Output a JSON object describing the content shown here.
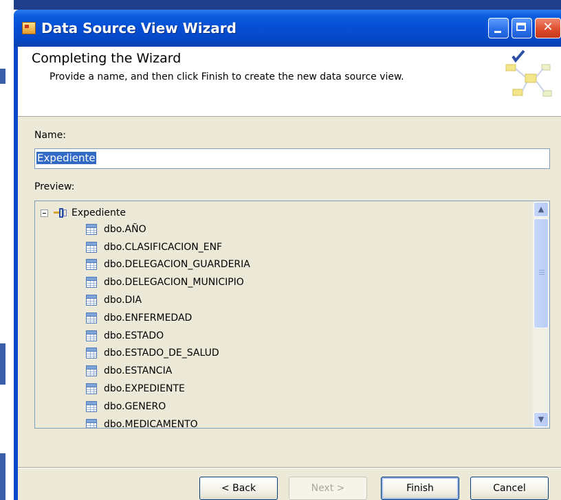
{
  "window": {
    "title": "Data Source View Wizard"
  },
  "header": {
    "title": "Completing the Wizard",
    "subtitle": "Provide a name, and then click Finish to create the new data source view."
  },
  "form": {
    "name_label": "Name:",
    "name_value": "Expediente",
    "preview_label": "Preview:"
  },
  "tree": {
    "root": "Expediente",
    "items": [
      "dbo.AÑO",
      "dbo.CLASIFICACION_ENF",
      "dbo.DELEGACION_GUARDERIA",
      "dbo.DELEGACION_MUNICIPIO",
      "dbo.DIA",
      "dbo.ENFERMEDAD",
      "dbo.ESTADO",
      "dbo.ESTADO_DE_SALUD",
      "dbo.ESTANCIA",
      "dbo.EXPEDIENTE",
      "dbo.GENERO",
      "dbo.MEDICAMENTO"
    ]
  },
  "buttons": {
    "back": "< Back",
    "next": "Next >",
    "finish": "Finish",
    "cancel": "Cancel"
  }
}
